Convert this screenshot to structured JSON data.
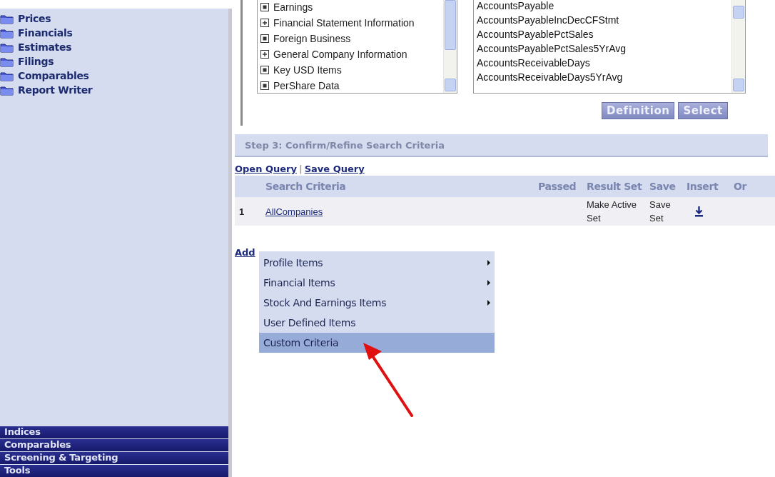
{
  "sidebar": {
    "folders": [
      {
        "label": "Prices"
      },
      {
        "label": "Financials"
      },
      {
        "label": "Estimates"
      },
      {
        "label": "Filings"
      },
      {
        "label": "Comparables"
      },
      {
        "label": "Report Writer"
      }
    ],
    "nav": [
      {
        "label": "Indices"
      },
      {
        "label": "Comparables"
      },
      {
        "label": "Screening & Targeting"
      },
      {
        "label": "Tools"
      }
    ]
  },
  "category_tree": {
    "items": [
      {
        "label": "Earnings",
        "kind": "leaf"
      },
      {
        "label": "Financial Statement Information",
        "kind": "group"
      },
      {
        "label": "Foreign Business",
        "kind": "leaf"
      },
      {
        "label": "General Company Information",
        "kind": "group"
      },
      {
        "label": "Key USD Items",
        "kind": "leaf"
      },
      {
        "label": "PerShare Data",
        "kind": "leaf"
      }
    ]
  },
  "item_list": {
    "items": [
      "AccountsPayable",
      "AccountsPayableIncDecCFStmt",
      "AccountsPayablePctSales",
      "AccountsPayablePctSales5YrAvg",
      "AccountsReceivableDays",
      "AccountsReceivableDays5YrAvg"
    ]
  },
  "buttons": [
    "Definition",
    "Select"
  ],
  "step3": {
    "title": "Step 3:  Confirm/Refine Search Criteria",
    "links": [
      "Open Query",
      "Save Query"
    ],
    "separator": "|",
    "columns": [
      "Search Criteria",
      "Passed",
      "Result Set",
      "Save",
      "Insert",
      "Or"
    ],
    "rows": [
      {
        "number": "1",
        "criteria": "AllCompanies",
        "result_set": "Make Active Set",
        "save": "Save Set"
      }
    ],
    "add_item": "Add"
  },
  "menu": {
    "items": [
      {
        "label": "Profile Items",
        "submenu": true,
        "selected": false
      },
      {
        "label": "Financial Items",
        "submenu": true,
        "selected": false
      },
      {
        "label": "Stock And Earnings Items",
        "submenu": true,
        "selected": false
      },
      {
        "label": "User Defined Items",
        "submenu": false,
        "selected": false
      },
      {
        "label": "Custom Criteria",
        "submenu": false,
        "selected": true
      }
    ]
  }
}
